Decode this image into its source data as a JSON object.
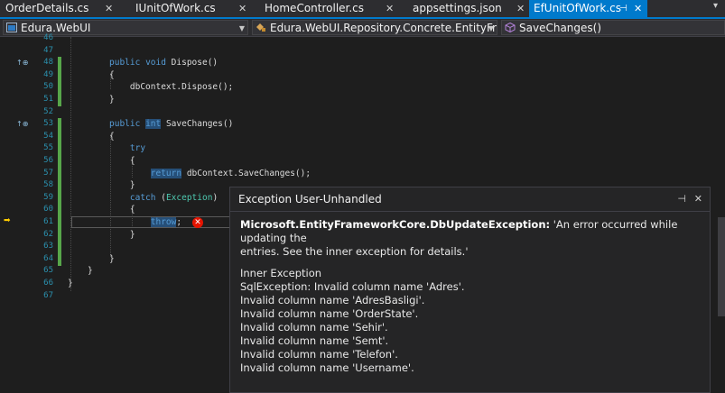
{
  "tabs": [
    {
      "label": "OrderDetails.cs",
      "active": false
    },
    {
      "label": "IUnitOfWork.cs",
      "active": false
    },
    {
      "label": "HomeController.cs",
      "active": false
    },
    {
      "label": "appsettings.json",
      "active": false
    },
    {
      "label": "EfUnitOfWork.cs",
      "active": true
    }
  ],
  "navbar": {
    "project": "Edura.WebUI",
    "class": "Edura.WebUI.Repository.Concrete.EntityFram",
    "member": "SaveChanges()"
  },
  "code_lines": [
    {
      "num": "46",
      "text": ""
    },
    {
      "num": "47",
      "text": ""
    },
    {
      "num": "48",
      "text": "public void Dispose()",
      "lens": "↑⊕"
    },
    {
      "num": "49",
      "text": "{"
    },
    {
      "num": "50",
      "text": "    dbContext.Dispose();"
    },
    {
      "num": "51",
      "text": "}"
    },
    {
      "num": "52",
      "text": ""
    },
    {
      "num": "53",
      "text": "public int SaveChanges()",
      "lens": "↑⊕"
    },
    {
      "num": "54",
      "text": "{"
    },
    {
      "num": "55",
      "text": "    try"
    },
    {
      "num": "56",
      "text": "    {"
    },
    {
      "num": "57",
      "text": "        return dbContext.SaveChanges();"
    },
    {
      "num": "58",
      "text": "    }"
    },
    {
      "num": "59",
      "text": "    catch (Exception)"
    },
    {
      "num": "60",
      "text": "    {"
    },
    {
      "num": "61",
      "text": "        throw;"
    },
    {
      "num": "62",
      "text": "    }"
    },
    {
      "num": "63",
      "text": ""
    },
    {
      "num": "64",
      "text": "}"
    },
    {
      "num": "65",
      "text": "}"
    },
    {
      "num": "66",
      "text": "}"
    },
    {
      "num": "67",
      "text": ""
    }
  ],
  "exception": {
    "title": "Exception User-Unhandled",
    "type": "Microsoft.EntityFrameworkCore.DbUpdateException:",
    "message_line1": " 'An error occurred while updating the",
    "message_line2": "entries. See the inner exception for details.'",
    "inner_header": "Inner Exception",
    "inner_lines": [
      "SqlException: Invalid column name 'Adres'.",
      "Invalid column name 'AdresBasligi'.",
      "Invalid column name 'OrderState'.",
      "Invalid column name 'Sehir'.",
      "Invalid column name 'Semt'.",
      "Invalid column name 'Telefon'.",
      "Invalid column name 'Username'."
    ],
    "pin_icon": "pin-icon",
    "close_icon": "close-icon"
  },
  "colors": {
    "accent": "#007acc",
    "keyword": "#569cd6",
    "type": "#4ec9b0",
    "line_number": "#2b91af",
    "error": "#e51400"
  }
}
